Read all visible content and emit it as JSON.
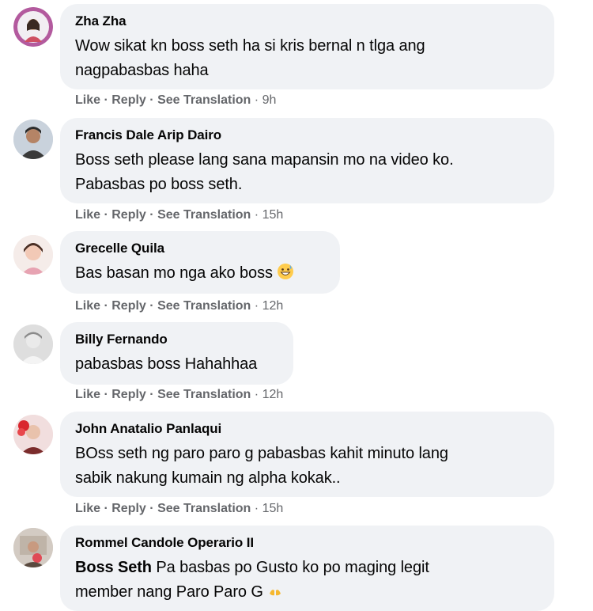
{
  "actions": {
    "like": "Like",
    "reply": "Reply",
    "see_translation": "See Translation",
    "separator": "·"
  },
  "comments": [
    {
      "name": "Zha Zha",
      "lines": [
        "Wow sikat kn boss seth ha si kris bernal n tlga ang",
        "nagpabasbas haha"
      ],
      "time": "9h"
    },
    {
      "name": "Francis Dale Arip Dairo",
      "lines": [
        "Boss seth please lang sana mapansin mo na video ko.",
        "Pabasbas po boss seth."
      ],
      "time": "15h"
    },
    {
      "name": "Grecelle Quila",
      "text": "Bas basan mo nga ako boss",
      "emoji": "grinning-sweat-face",
      "time": "12h"
    },
    {
      "name": "Billy Fernando",
      "text": "pabasbas boss Hahahhaa",
      "time": "12h"
    },
    {
      "name": "John Anatalio Panlaqui",
      "lines": [
        "BOss seth ng paro paro g pabasbas kahit minuto lang",
        "sabik nakung kumain ng alpha kokak.."
      ],
      "time": "15h"
    },
    {
      "name": "Rommel Candole Operario II",
      "mention": "Boss Seth",
      "line1_rest": " Pa basbas po Gusto ko po maging legit",
      "line2": "member nang Paro Paro G",
      "emoji": "folded-hands"
    }
  ]
}
